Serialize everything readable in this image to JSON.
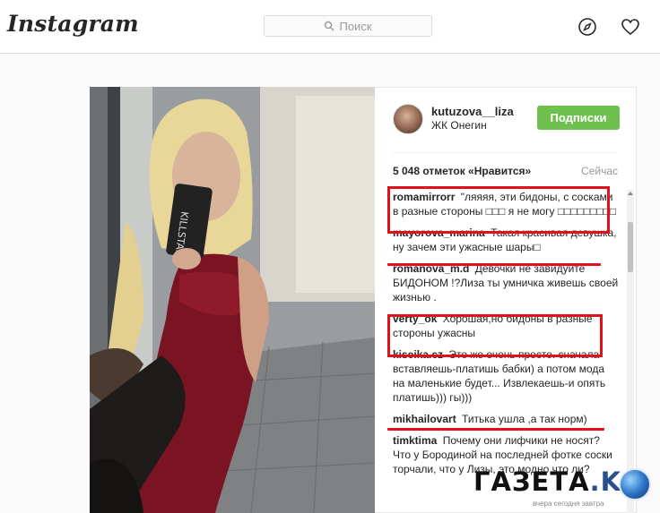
{
  "app": {
    "logo": "Instagram"
  },
  "header": {
    "search_placeholder": "Поиск",
    "nav_icons": [
      "compass-icon",
      "heart-icon"
    ]
  },
  "post": {
    "author": {
      "username": "kutuzova__liza",
      "location": "ЖК Онегин"
    },
    "follow_label": "Подписки",
    "likes": "5 048 отметок «Нравится»",
    "time": "Сейчас"
  },
  "comments": [
    {
      "user": "romamirrorr",
      "text": "\"ляяяя, эти бидоны, с сосками в разные стороны □□□ я не могу □□□□□□□□□"
    },
    {
      "user": "mayorova_marina",
      "text": "Такая красивая девушка, ну зачем эти ужасные шары□"
    },
    {
      "user": "romanova_m.d",
      "text": "Девочки не завидуйте БИДОНОМ !?Лиза ты умничка живешь своей жизнью ."
    },
    {
      "user": "verty_ok",
      "text": "Хорошая,но бидоны в разные стороны ужасны"
    },
    {
      "user": "kiseika.cz",
      "text": "Это же очень просто. сначала вставляешь-платишь бабки) а потом мода на маленькие будет... Извлекаешь-и опять платишь))) гы)))"
    },
    {
      "user": "mikhailovart",
      "text": "Титька ушла ,а так норм)"
    },
    {
      "user": "timktima",
      "text": "Почему они лифчики не носят? Что у Бородиной на последней фотке соски торчали, что у Лизы, это модно что ли?"
    }
  ],
  "watermark": {
    "brand": "ГАЗЕТА",
    "domain": ".KG",
    "tagline": "вчера сегодня завтра"
  },
  "colors": {
    "follow_button": "#70c050",
    "highlight": "#e0101c",
    "brand_blue": "#2a4f8d"
  }
}
